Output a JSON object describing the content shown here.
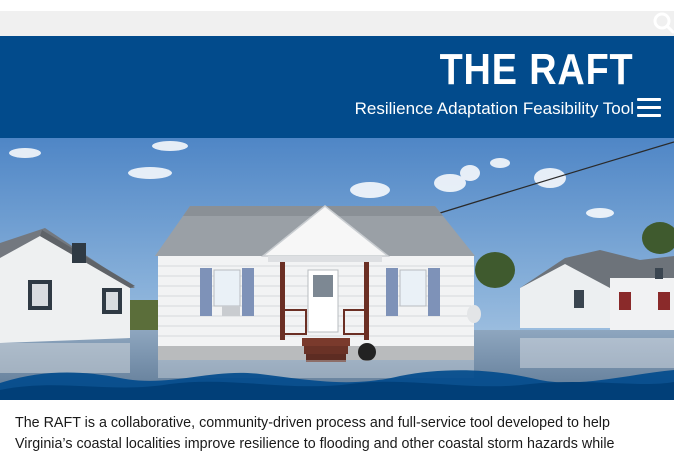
{
  "header": {
    "title": "THE RAFT",
    "subtitle": "Resilience Adaptation Feasibility Tool"
  },
  "icons": {
    "search": "search-icon",
    "menu": "hamburger-menu-icon"
  },
  "hero": {
    "description": "Flooded white house with porch steps standing in floodwater"
  },
  "intro": {
    "text": "The RAFT is a collaborative, community-driven process and full-service tool developed to help Virginia’s coastal localities improve resilience to flooding and other coastal storm hazards while"
  },
  "colors": {
    "brand_blue": "#024b8c",
    "search_bar_bg": "#f0f0f0",
    "text": "#1a1a1a"
  }
}
